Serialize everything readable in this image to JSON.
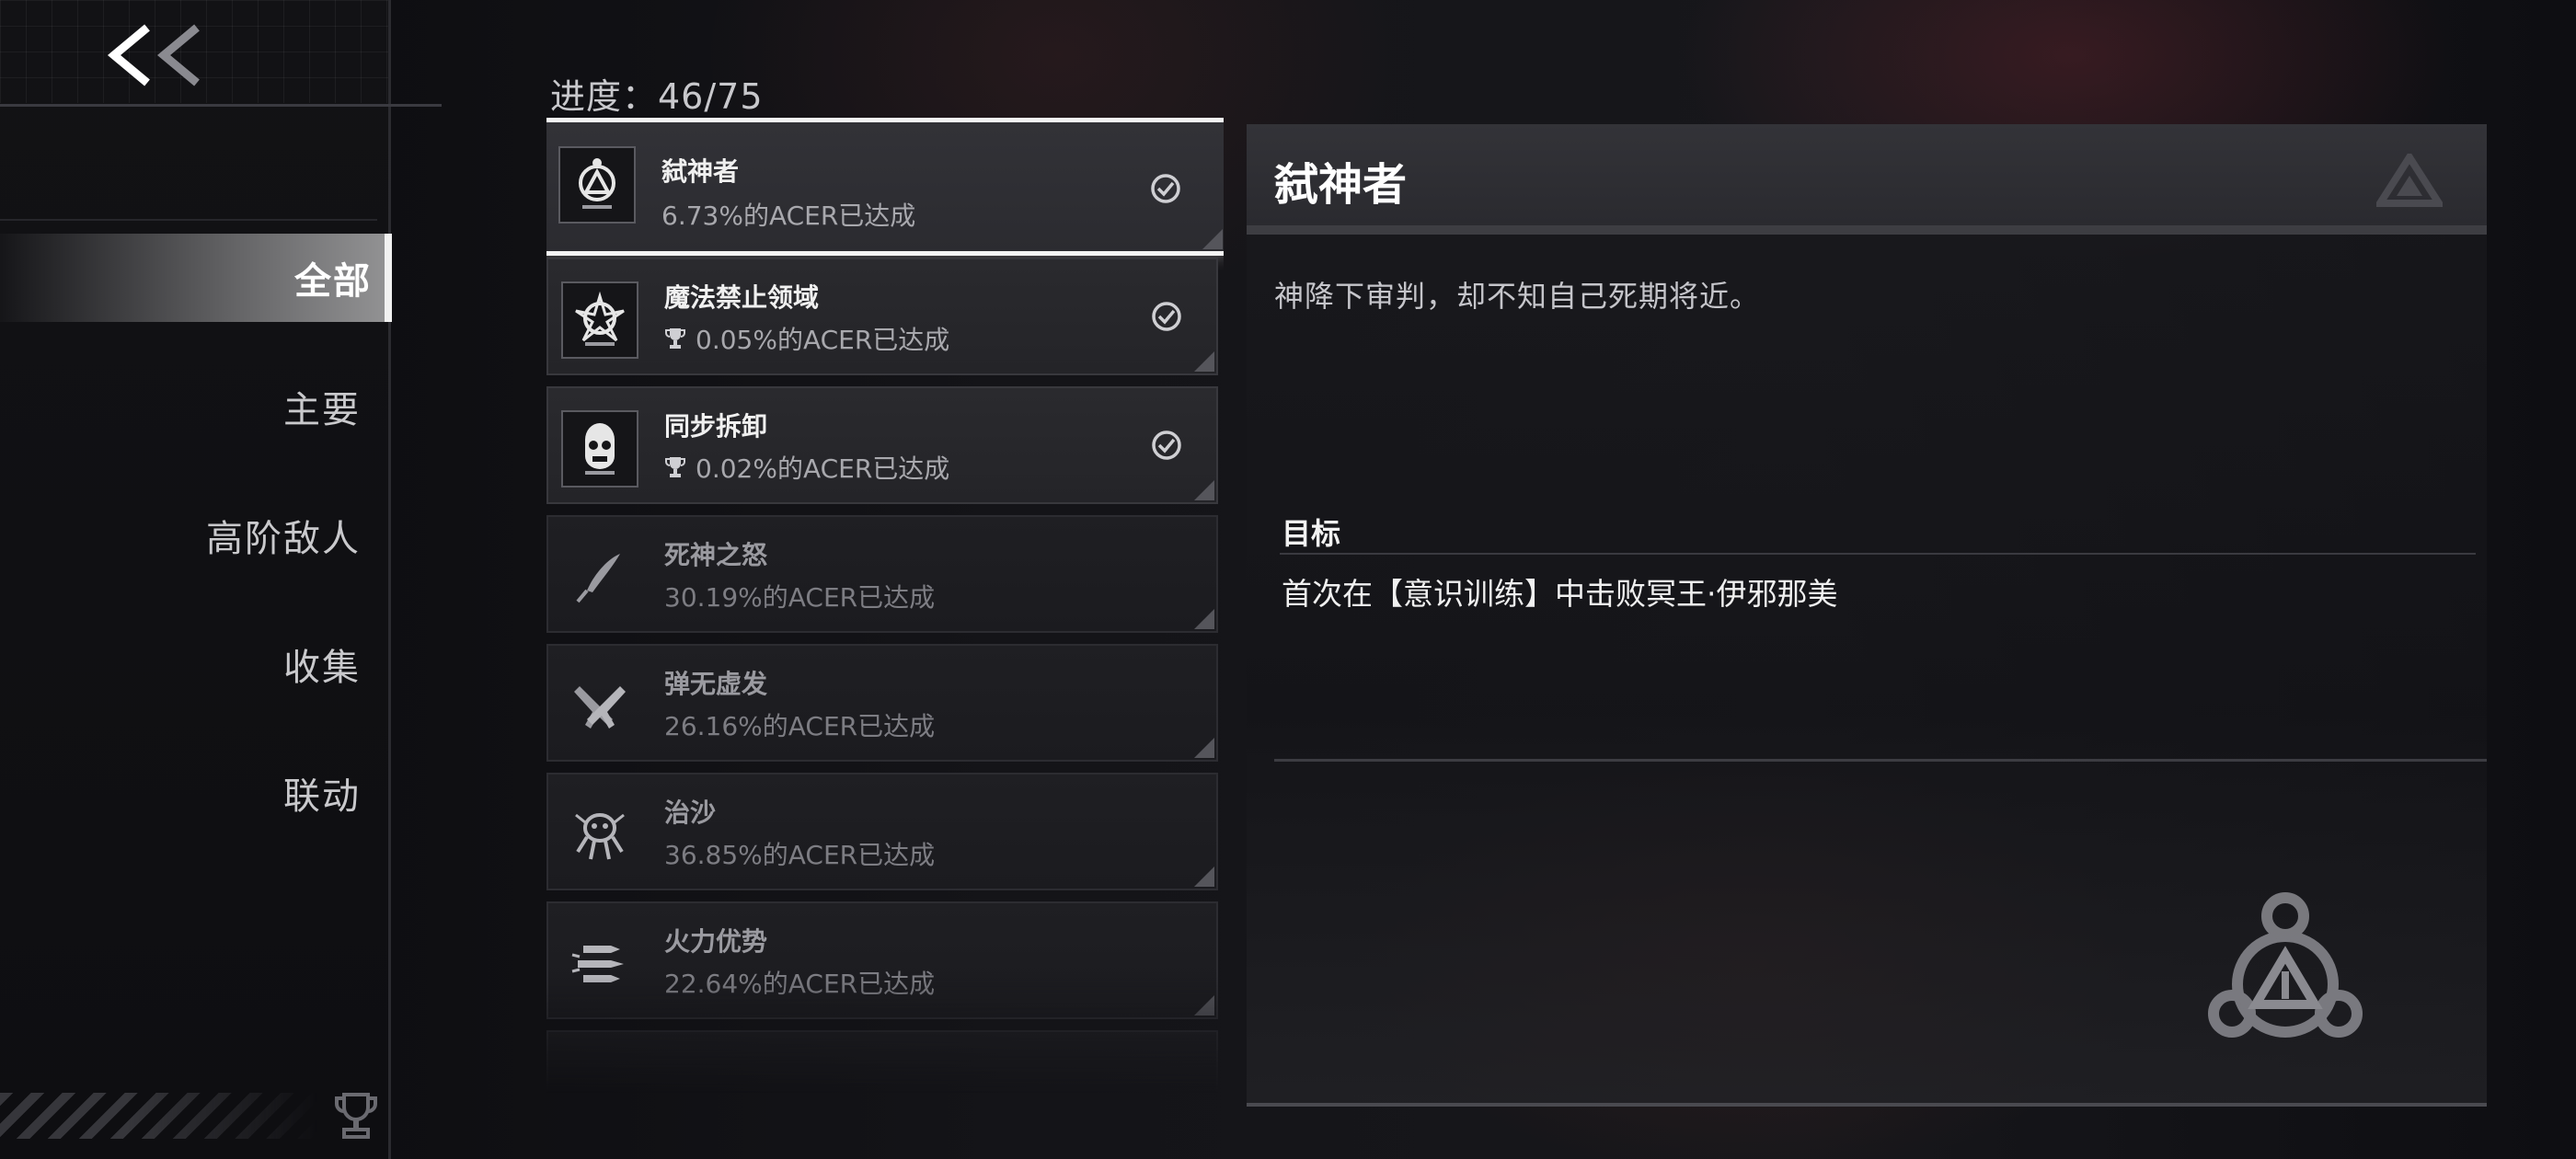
{
  "sidebar": {
    "back_label": "<<",
    "items": [
      {
        "label": "全部",
        "active": true
      },
      {
        "label": "主要",
        "active": false
      },
      {
        "label": "高阶敌人",
        "active": false
      },
      {
        "label": "收集",
        "active": false
      },
      {
        "label": "联动",
        "active": false
      }
    ]
  },
  "progress": "进度：46/75",
  "achievements": [
    {
      "title": "弑神者",
      "rate": "6.73%的ACER已达成",
      "completed": true,
      "trophy": false,
      "icon": "deity-emblem-icon"
    },
    {
      "title": "魔法禁止领域",
      "rate": "0.05%的ACER已达成",
      "completed": true,
      "trophy": true,
      "icon": "shattered-emblem-icon"
    },
    {
      "title": "同步拆卸",
      "rate": "0.02%的ACER已达成",
      "completed": true,
      "trophy": true,
      "icon": "robot-head-icon"
    },
    {
      "title": "死神之怒",
      "rate": "30.19%的ACER已达成",
      "completed": false,
      "trophy": false,
      "icon": "feather-blade-icon"
    },
    {
      "title": "弹无虚发",
      "rate": "26.16%的ACER已达成",
      "completed": false,
      "trophy": false,
      "icon": "crossed-pistols-icon"
    },
    {
      "title": "治沙",
      "rate": "36.85%的ACER已达成",
      "completed": false,
      "trophy": false,
      "icon": "sand-creature-icon"
    },
    {
      "title": "火力优势",
      "rate": "22.64%的ACER已达成",
      "completed": false,
      "trophy": false,
      "icon": "bullets-icon"
    }
  ],
  "detail": {
    "title": "弑神者",
    "description": "神降下审判，却不知自己死期将近。",
    "goal_label": "目标",
    "goal_text": "首次在【意识训练】中击败冥王·伊邪那美"
  },
  "colors": {
    "background": "#0c0c0f",
    "card": "#2a2a2e",
    "selected_border": "#f4f4f4",
    "text_primary": "#f0f0f0",
    "text_secondary": "#a8a8ad"
  }
}
